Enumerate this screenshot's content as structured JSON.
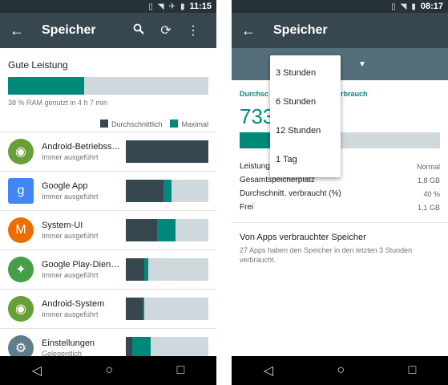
{
  "left": {
    "status": {
      "time": "11:15"
    },
    "appbar": {
      "title": "Speicher",
      "back_icon": "arrow-back-icon",
      "search_icon": "search-icon",
      "refresh_icon": "refresh-icon",
      "more_icon": "more-vert-icon"
    },
    "performance": {
      "title": "Gute Leistung",
      "usage_fraction": 0.38,
      "subtitle": "38 % RAM genutzt in 4 h 7 min"
    },
    "legend": {
      "average": "Durchschnittlich",
      "maximum": "Maximal"
    },
    "apps": [
      {
        "name": "Android-Betriebss…",
        "status": "Immer ausgeführt",
        "avg": 1.0,
        "max": 1.0
      },
      {
        "name": "Google App",
        "status": "Immer ausgeführt",
        "avg": 0.46,
        "max": 0.55
      },
      {
        "name": "System-UI",
        "status": "Immer ausgeführt",
        "avg": 0.38,
        "max": 0.6
      },
      {
        "name": "Google Play-Dien…",
        "status": "Immer ausgeführt",
        "avg": 0.22,
        "max": 0.27
      },
      {
        "name": "Android-System",
        "status": "Immer ausgeführt",
        "avg": 0.2,
        "max": 0.22
      },
      {
        "name": "Einstellungen",
        "status": "Gelegentlich",
        "avg": 0.08,
        "max": 0.3
      }
    ]
  },
  "right": {
    "status": {
      "time": "08:17"
    },
    "appbar": {
      "title": "Speicher",
      "back_icon": "arrow-back-icon"
    },
    "dropdown": {
      "options": [
        "3 Stunden",
        "6 Stunden",
        "12 Stunden",
        "1 Tag"
      ]
    },
    "usage": {
      "title_left": "Durchsc",
      "title_right": "rbrauch",
      "value": "733",
      "fill_fraction": 0.4
    },
    "stats": [
      {
        "label": "Leistung",
        "value": "Normal"
      },
      {
        "label": "Gesamtspeicherplatz",
        "value": "1,8 GB"
      },
      {
        "label": "Durchschnitt. verbraucht (%)",
        "value": "40 %"
      },
      {
        "label": "Frei",
        "value": "1,1 GB"
      }
    ],
    "apps_section": {
      "title": "Von Apps verbrauchter Speicher",
      "desc": "27 Apps haben den Speicher in den letzten 3 Stunden verbraucht."
    }
  },
  "colors": {
    "accent": "#00897b",
    "appbar": "#37474f",
    "statusbar": "#263238",
    "average": "#37474f",
    "track": "#cfd8dc"
  }
}
